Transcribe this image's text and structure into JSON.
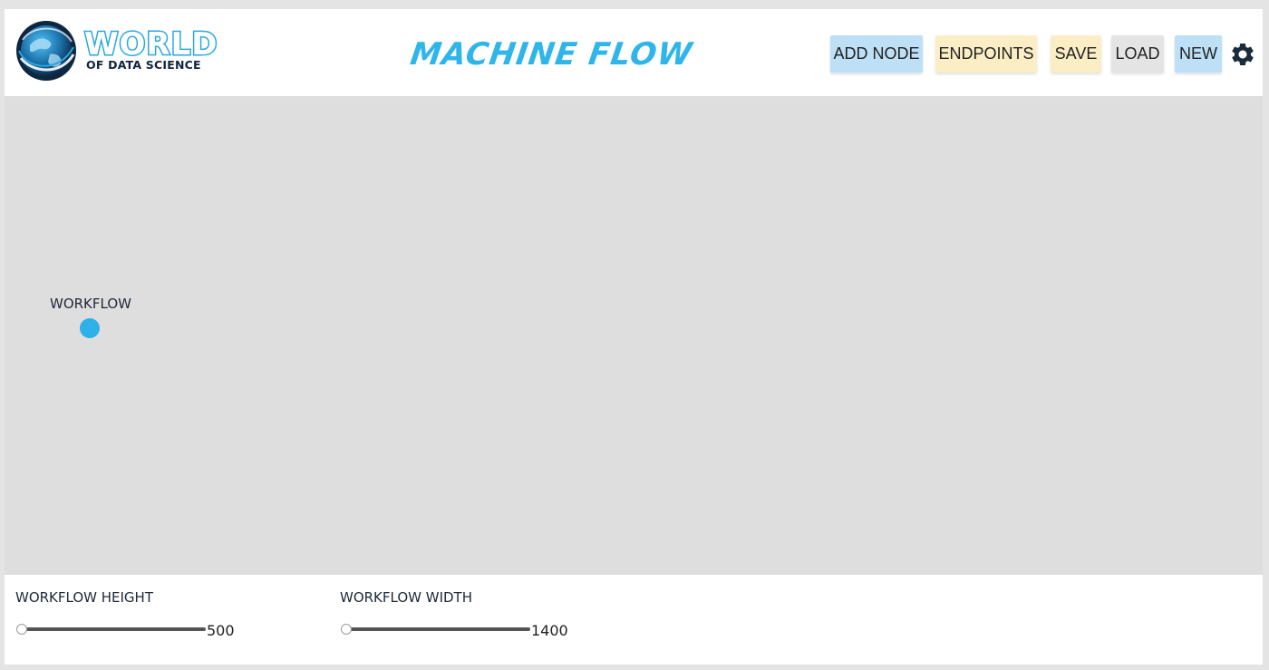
{
  "brand": {
    "logo_main": "WORLD",
    "logo_sub": "OF DATA SCIENCE",
    "app_title": "MACHINE FLOW"
  },
  "toolbar": {
    "add_node": "ADD NODE",
    "endpoints": "ENDPOINTS",
    "save": "SAVE",
    "load": "LOAD",
    "new": "NEW",
    "settings_icon": "gear-icon"
  },
  "canvas": {
    "node_label": "WORKFLOW"
  },
  "controls": {
    "height": {
      "label": "WORKFLOW HEIGHT",
      "value": "500"
    },
    "width": {
      "label": "WORKFLOW WIDTH",
      "value": "1400"
    }
  },
  "colors": {
    "accent": "#2eb5ea",
    "btn_blue": "#bde0f6",
    "btn_yellow": "#fbeec5",
    "btn_gray": "#e4e4e4",
    "canvas_bg": "#dedede"
  }
}
